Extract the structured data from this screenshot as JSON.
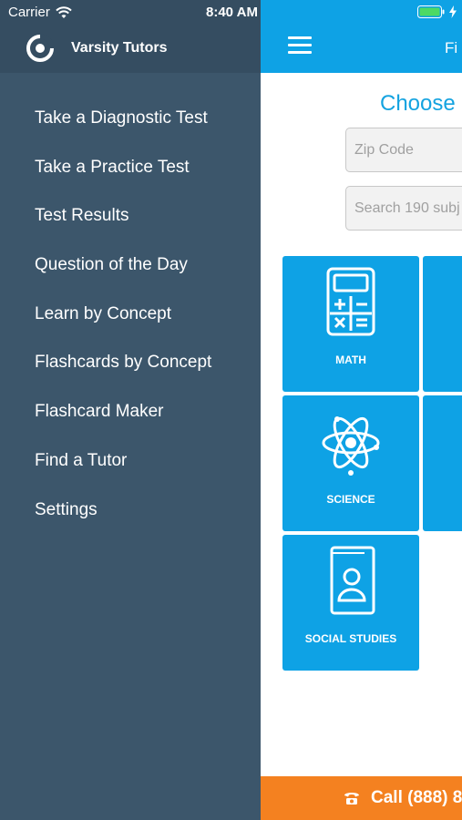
{
  "status_bar": {
    "carrier": "Carrier",
    "time": "8:40 AM"
  },
  "brand": {
    "name": "Varsity Tutors"
  },
  "menu": {
    "items": [
      {
        "label": "Take a Diagnostic Test"
      },
      {
        "label": "Take a Practice Test"
      },
      {
        "label": "Test Results"
      },
      {
        "label": "Question of the Day"
      },
      {
        "label": "Learn by Concept"
      },
      {
        "label": "Flashcards by Concept"
      },
      {
        "label": "Flashcard Maker"
      },
      {
        "label": "Find a Tutor"
      },
      {
        "label": "Settings"
      }
    ]
  },
  "main": {
    "header_fragment": "Fi",
    "choose_title": "Choose",
    "zip_placeholder": "Zip Code",
    "search_placeholder": "Search 190 subj",
    "tiles": [
      {
        "label": "MATH",
        "icon": "calculator-icon"
      },
      {
        "label": "SCIENCE",
        "icon": "atom-icon"
      },
      {
        "label": "SOCIAL STUDIES",
        "icon": "contact-book-icon"
      }
    ],
    "call_label": "Call (888) 8"
  },
  "colors": {
    "drawer_bg": "#3c566b",
    "header_blue": "#0ea2e5",
    "tile_blue": "#0ea2e5",
    "call_orange": "#f48120",
    "title_blue": "#14a3e0"
  }
}
